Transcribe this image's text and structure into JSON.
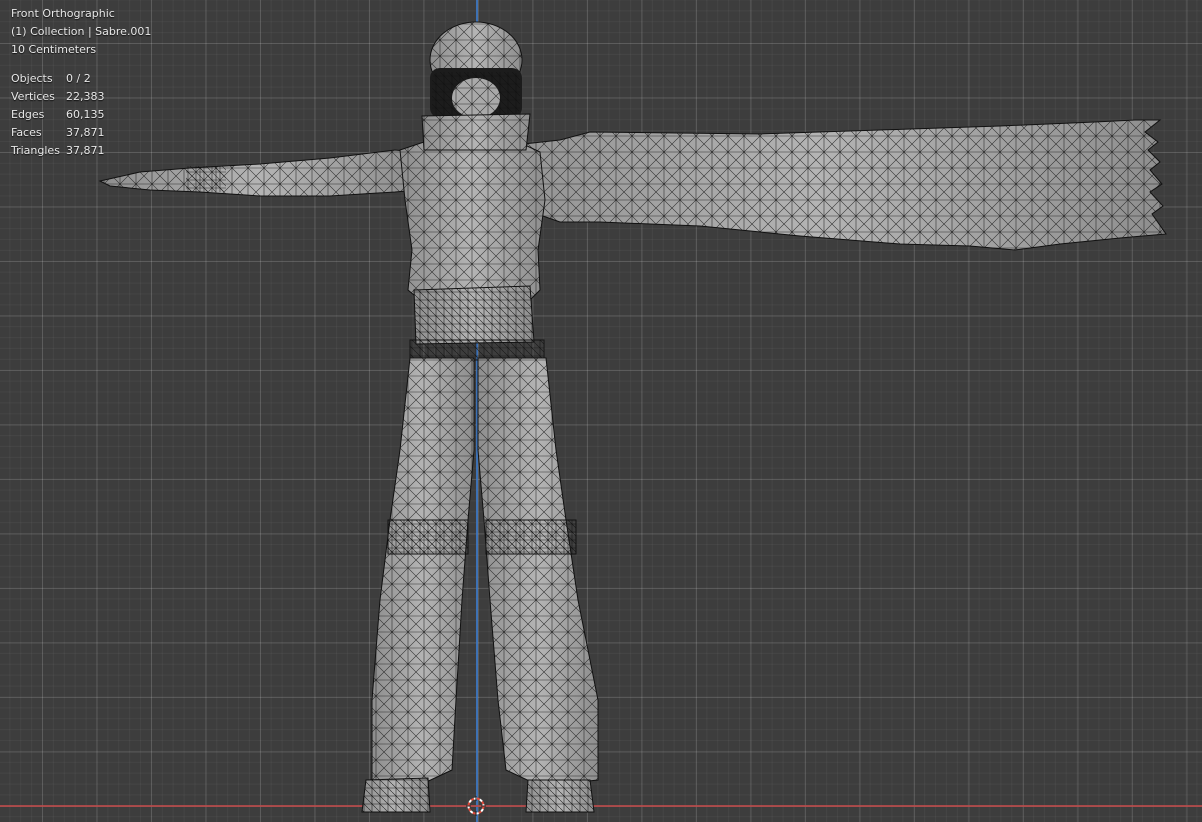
{
  "viewport": {
    "view_name": "Front Orthographic",
    "collection_text": "(1) Collection | Sabre.001",
    "scale_text": "10 Centimeters"
  },
  "stats": [
    {
      "label": "Objects",
      "value": "0 / 2"
    },
    {
      "label": "Vertices",
      "value": "22,383"
    },
    {
      "label": "Edges",
      "value": "60,135"
    },
    {
      "label": "Faces",
      "value": "37,871"
    },
    {
      "label": "Triangles",
      "value": "37,871"
    }
  ],
  "colors": {
    "background": "#3d3d3d",
    "z_axis": "#3d7ac9",
    "x_axis": "#b84a4a",
    "mesh_fill": "#a8a8a8",
    "wire": "#111111",
    "cursor_red": "#e04a3a"
  },
  "icons": {
    "cursor": "3d-cursor-icon"
  }
}
